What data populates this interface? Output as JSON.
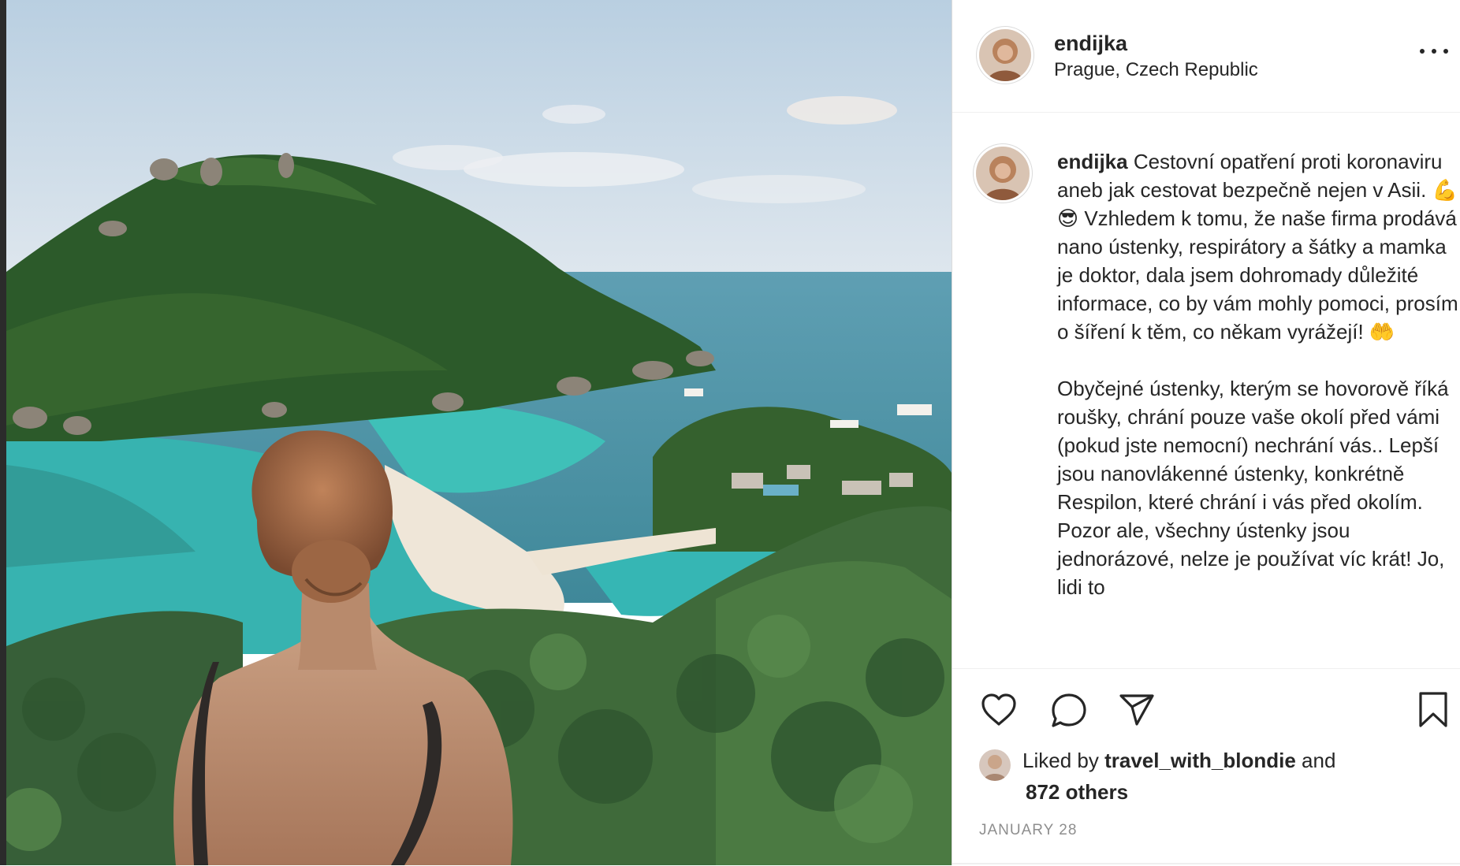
{
  "post": {
    "username": "endijka",
    "location": "Prague, Czech Republic",
    "caption_text": " Cestovní opatření proti koronaviru aneb jak cestovat bezpečně nejen v Asii. 💪😎 Vzhledem k tomu, že naše firma prodává nano ústenky, respirátory a šátky a mamka je doktor, dala jsem dohromady důležité informace, co by vám mohly pomoci, prosím o šíření k těm, co někam vyrážejí! 🤲\n\nObyčejné ústenky, kterým se hovorově říká roušky, chrání pouze vaše okolí před vámi (pokud jste nemocní) nechrání vás.. Lepší jsou nanovlákenné ústenky, konkrétně Respilon, které chrání i vás před okolím. Pozor ale, všechny ústenky jsou jednorázové, nelze je používat víc krát! Jo, lidi to",
    "liked_by_prefix": "Liked by ",
    "liked_by_user": "travel_with_blondie",
    "liked_by_mid": " and ",
    "liked_by_count": "872 others",
    "date": "JANUARY 28"
  },
  "icons": {
    "more": "more-options-icon",
    "like": "heart-icon",
    "comment": "comment-bubble-icon",
    "share": "paper-plane-icon",
    "save": "bookmark-icon"
  },
  "colors": {
    "text": "#262626",
    "muted": "#8e8e8e",
    "border": "#dbdbdb"
  }
}
